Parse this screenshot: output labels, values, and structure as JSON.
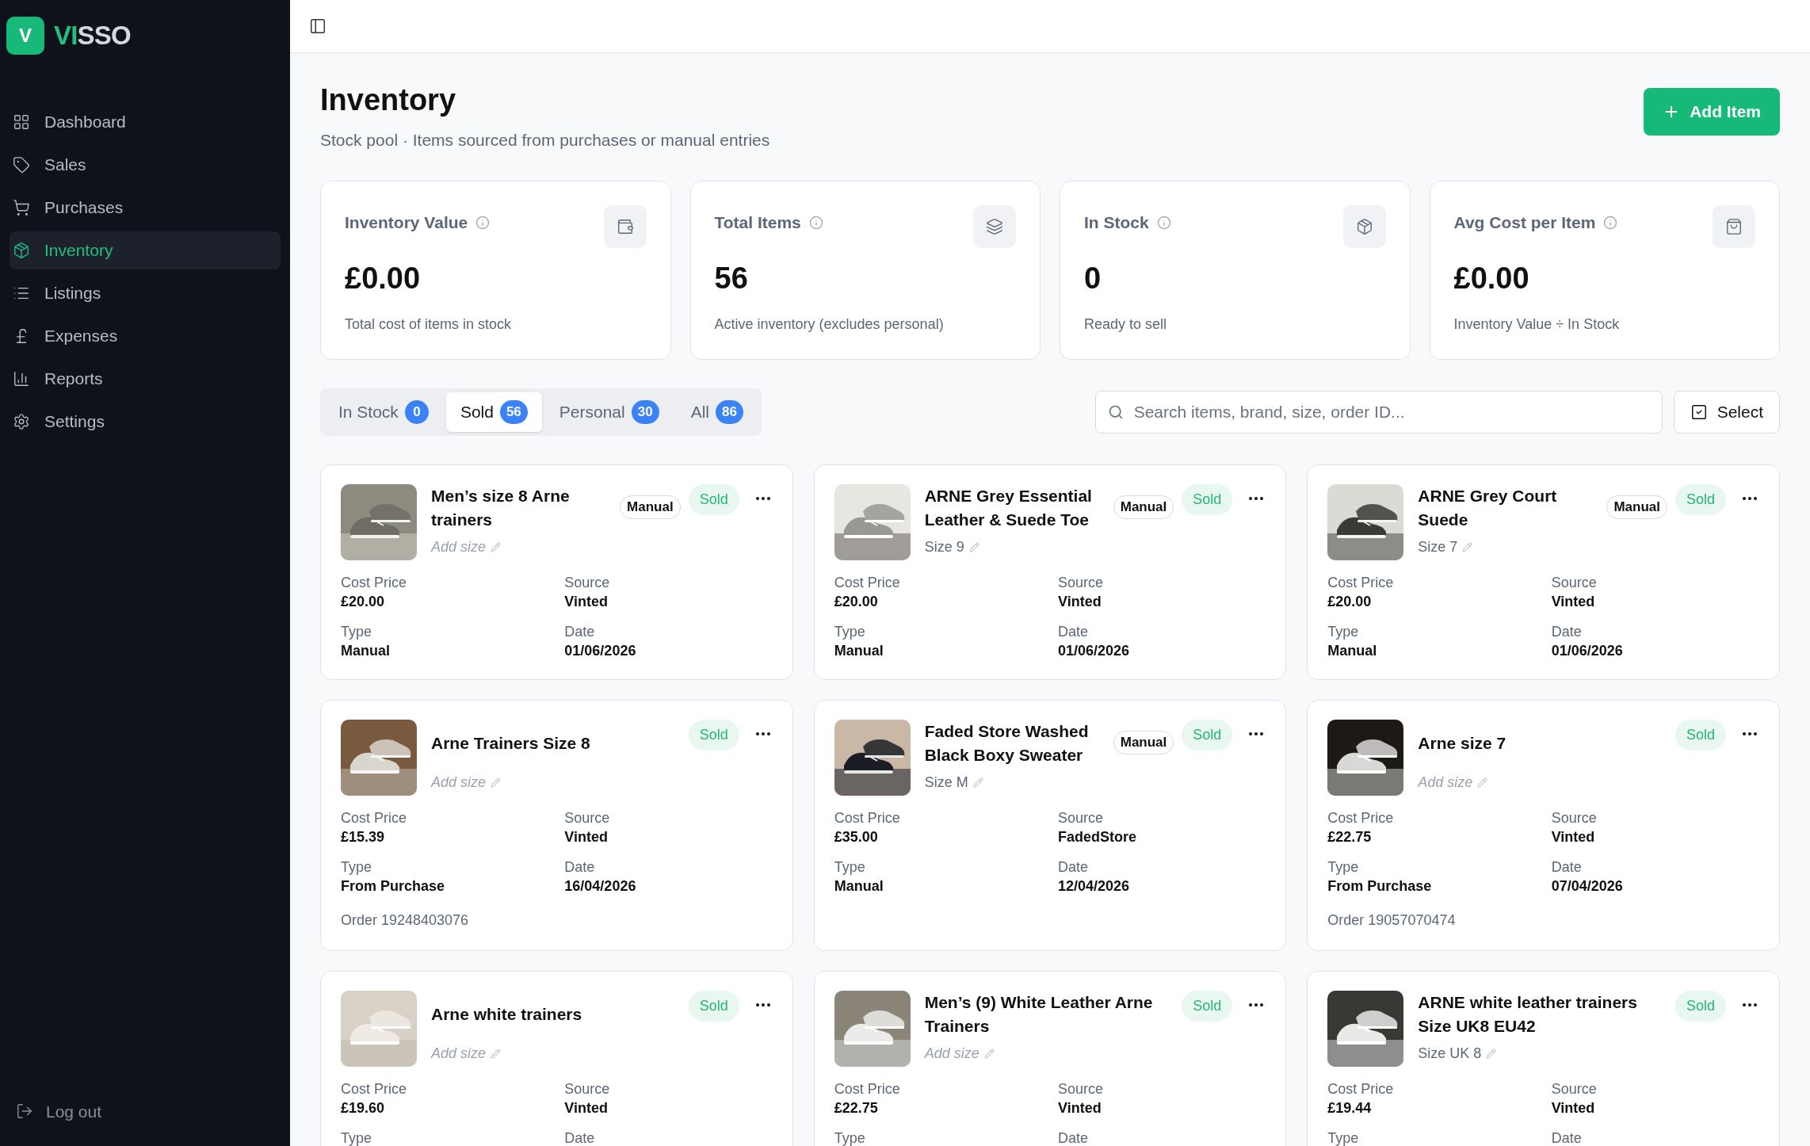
{
  "brand": {
    "mark": "V",
    "accent": "VI",
    "rest": "SSO"
  },
  "sidebar": {
    "items": [
      {
        "label": "Dashboard",
        "selected": false
      },
      {
        "label": "Sales",
        "selected": false
      },
      {
        "label": "Purchases",
        "selected": false
      },
      {
        "label": "Inventory",
        "selected": true
      },
      {
        "label": "Listings",
        "selected": false
      },
      {
        "label": "Expenses",
        "selected": false
      },
      {
        "label": "Reports",
        "selected": false
      },
      {
        "label": "Settings",
        "selected": false
      }
    ],
    "logout": "Log out"
  },
  "header": {
    "title": "Inventory",
    "subtitle": "Stock pool · Items sourced from purchases or manual entries",
    "add_button": "Add Item"
  },
  "stats": [
    {
      "label": "Inventory Value",
      "value": "£0.00",
      "caption": "Total cost of items in stock"
    },
    {
      "label": "Total Items",
      "value": "56",
      "caption": "Active inventory (excludes personal)"
    },
    {
      "label": "In Stock",
      "value": "0",
      "caption": "Ready to sell"
    },
    {
      "label": "Avg Cost per Item",
      "value": "£0.00",
      "caption": "Inventory Value ÷ In Stock"
    }
  ],
  "tabs": [
    {
      "label": "In Stock",
      "count": "0",
      "selected": false
    },
    {
      "label": "Sold",
      "count": "56",
      "selected": true
    },
    {
      "label": "Personal",
      "count": "30",
      "selected": false
    },
    {
      "label": "All",
      "count": "86",
      "selected": false
    }
  ],
  "search": {
    "placeholder": "Search items, brand, size, order ID..."
  },
  "select_button": "Select",
  "items": [
    {
      "title": "Men’s size 8 Arne trainers",
      "size": "Add size",
      "size_empty": true,
      "badge": "Manual",
      "status": "Sold",
      "fields": [
        {
          "label": "Cost Price",
          "value": "£20.00"
        },
        {
          "label": "Source",
          "value": "Vinted"
        },
        {
          "label": "Type",
          "value": "Manual"
        },
        {
          "label": "Date",
          "value": "01/06/2026"
        }
      ]
    },
    {
      "title": "ARNE Grey Essential Leather & Suede Toe",
      "size": "Size 9",
      "size_empty": false,
      "badge": "Manual",
      "status": "Sold",
      "fields": [
        {
          "label": "Cost Price",
          "value": "£20.00"
        },
        {
          "label": "Source",
          "value": "Vinted"
        },
        {
          "label": "Type",
          "value": "Manual"
        },
        {
          "label": "Date",
          "value": "01/06/2026"
        }
      ]
    },
    {
      "title": "ARNE Grey Court Suede",
      "size": "Size 7",
      "size_empty": false,
      "badge": "Manual",
      "status": "Sold",
      "fields": [
        {
          "label": "Cost Price",
          "value": "£20.00"
        },
        {
          "label": "Source",
          "value": "Vinted"
        },
        {
          "label": "Type",
          "value": "Manual"
        },
        {
          "label": "Date",
          "value": "01/06/2026"
        }
      ]
    },
    {
      "title": "Arne Trainers Size 8",
      "size": "Add size",
      "size_empty": true,
      "status": "Sold",
      "fields": [
        {
          "label": "Cost Price",
          "value": "£15.39"
        },
        {
          "label": "Source",
          "value": "Vinted"
        },
        {
          "label": "Type",
          "value": "From Purchase"
        },
        {
          "label": "Date",
          "value": "16/04/2026"
        }
      ],
      "order": "Order 19248403076"
    },
    {
      "title": "Faded Store Washed Black Boxy Sweater",
      "size": "Size M",
      "size_empty": false,
      "badge": "Manual",
      "status": "Sold",
      "fields": [
        {
          "label": "Cost Price",
          "value": "£35.00"
        },
        {
          "label": "Source",
          "value": "FadedStore"
        },
        {
          "label": "Type",
          "value": "Manual"
        },
        {
          "label": "Date",
          "value": "12/04/2026"
        }
      ]
    },
    {
      "title": "Arne size 7",
      "size": "Add size",
      "size_empty": true,
      "status": "Sold",
      "fields": [
        {
          "label": "Cost Price",
          "value": "£22.75"
        },
        {
          "label": "Source",
          "value": "Vinted"
        },
        {
          "label": "Type",
          "value": "From Purchase"
        },
        {
          "label": "Date",
          "value": "07/04/2026"
        }
      ],
      "order": "Order 19057070474"
    },
    {
      "title": "Arne white trainers",
      "size": "Add size",
      "size_empty": true,
      "status": "Sold",
      "fields": [
        {
          "label": "Cost Price",
          "value": "£19.60"
        },
        {
          "label": "Source",
          "value": "Vinted"
        },
        {
          "label": "Type"
        },
        {
          "label": "Date"
        }
      ]
    },
    {
      "title": "Men’s (9) White Leather Arne Trainers",
      "size": "Add size",
      "size_empty": true,
      "status": "Sold",
      "fields": [
        {
          "label": "Cost Price",
          "value": "£22.75"
        },
        {
          "label": "Source",
          "value": "Vinted"
        },
        {
          "label": "Type"
        },
        {
          "label": "Date"
        }
      ]
    },
    {
      "title": "ARNE white leather trainers Size UK8 EU42",
      "size": "Size UK 8",
      "size_empty": false,
      "status": "Sold",
      "fields": [
        {
          "label": "Cost Price",
          "value": "£19.44"
        },
        {
          "label": "Source",
          "value": "Vinted"
        },
        {
          "label": "Type"
        },
        {
          "label": "Date"
        }
      ]
    }
  ]
}
